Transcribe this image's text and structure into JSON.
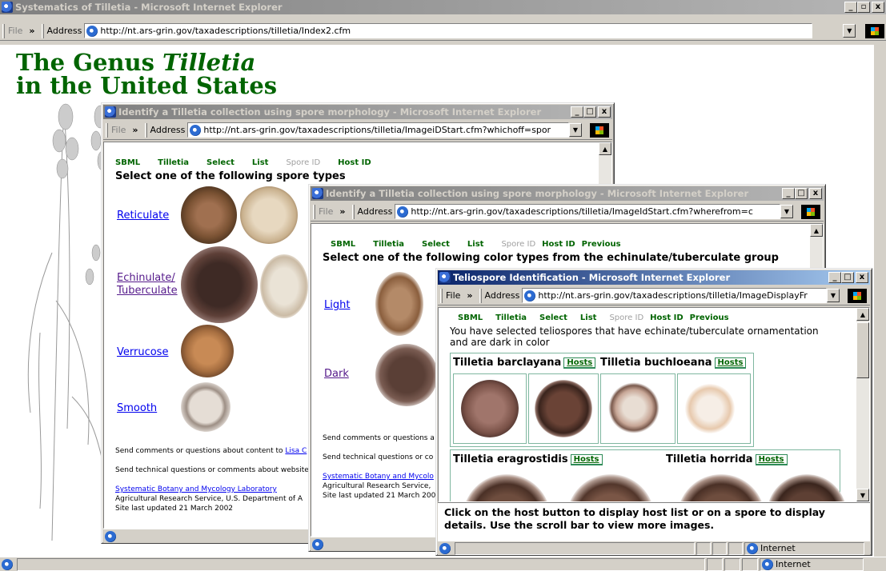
{
  "main": {
    "title": "Systematics of Tilletia - Microsoft Internet Explorer",
    "menu_file": "File",
    "address_label": "Address",
    "url": "http://nt.ars-grin.gov/taxadescriptions/tilletia/Index2.cfm",
    "heading_line1_a": "The Genus ",
    "heading_line1_b": "Tilletia",
    "heading_line2": "in the United States",
    "status_zone": "Internet"
  },
  "win2": {
    "title": "Identify a Tilletia collection using spore morphology - Microsoft Internet Explorer",
    "menu_file": "File",
    "address_label": "Address",
    "url": "http://nt.ars-grin.gov/taxadescriptions/tilletia/ImageiDStart.cfm?whichoff=spor",
    "nav": [
      "SBML",
      "Tilletia",
      "Select",
      "List",
      "Spore ID",
      "Host ID"
    ],
    "heading": "Select one of the following spore types",
    "links": [
      "Reticulate",
      "Echinulate/",
      "Tuberculate",
      "Verrucose",
      "Smooth"
    ],
    "footer_comments": "Send comments or questions about content to",
    "footer_contact": "Lisa C",
    "footer_tech": "Send technical questions or comments about website",
    "footer_lab": "Systematic Botany and Mycology Laboratory",
    "footer_ars": "Agricultural Research Service, U.S. Department of A",
    "footer_updated": "Site last updated 21 March 2002"
  },
  "win3": {
    "title": "Identify a Tilletia collection using spore morphology - Microsoft Internet Explorer",
    "menu_file": "File",
    "address_label": "Address",
    "url": "http://nt.ars-grin.gov/taxadescriptions/tilletia/ImageIdStart.cfm?wherefrom=c",
    "nav": [
      "SBML",
      "Tilletia",
      "Select",
      "List",
      "Spore ID",
      "Host ID",
      "Previous"
    ],
    "heading": "Select one of the following color types from the echinulate/tuberculate group",
    "links": [
      "Light",
      "Dark"
    ],
    "footer_comments": "Send comments or questions a",
    "footer_tech": "Send technical questions or co",
    "footer_lab": "Systematic Botany and Mycolo",
    "footer_ars": "Agricultural Research Service,",
    "footer_updated": "Site last updated 21 March 200"
  },
  "win4": {
    "title": "Teliospore Identification - Microsoft Internet Explorer",
    "menu_file": "File",
    "address_label": "Address",
    "url": "http://nt.ars-grin.gov/taxadescriptions/tilletia/ImageDisplayFr",
    "nav": [
      "SBML",
      "Tilletia",
      "Select",
      "List",
      "Spore ID",
      "Host ID",
      "Previous"
    ],
    "intro_line1": "You have selected teliospores that have echinate/tuberculate ornamentation",
    "intro_line2": "and are dark in color",
    "species": [
      "Tilletia barclayana",
      "Tilletia buchloeana",
      "Tilletia eragrostidis",
      "Tilletia horrida"
    ],
    "hosts_label": "Hosts",
    "footer_line1": "Click on the host button to display host list or on a spore to display",
    "footer_line2": "details.  Use the scroll bar to view more images.",
    "status_zone": "Internet"
  },
  "colors": {
    "title_active": "#0a246a",
    "title_inactive": "#808080",
    "heading_green": "#006400",
    "link_blue": "#0000ee"
  }
}
